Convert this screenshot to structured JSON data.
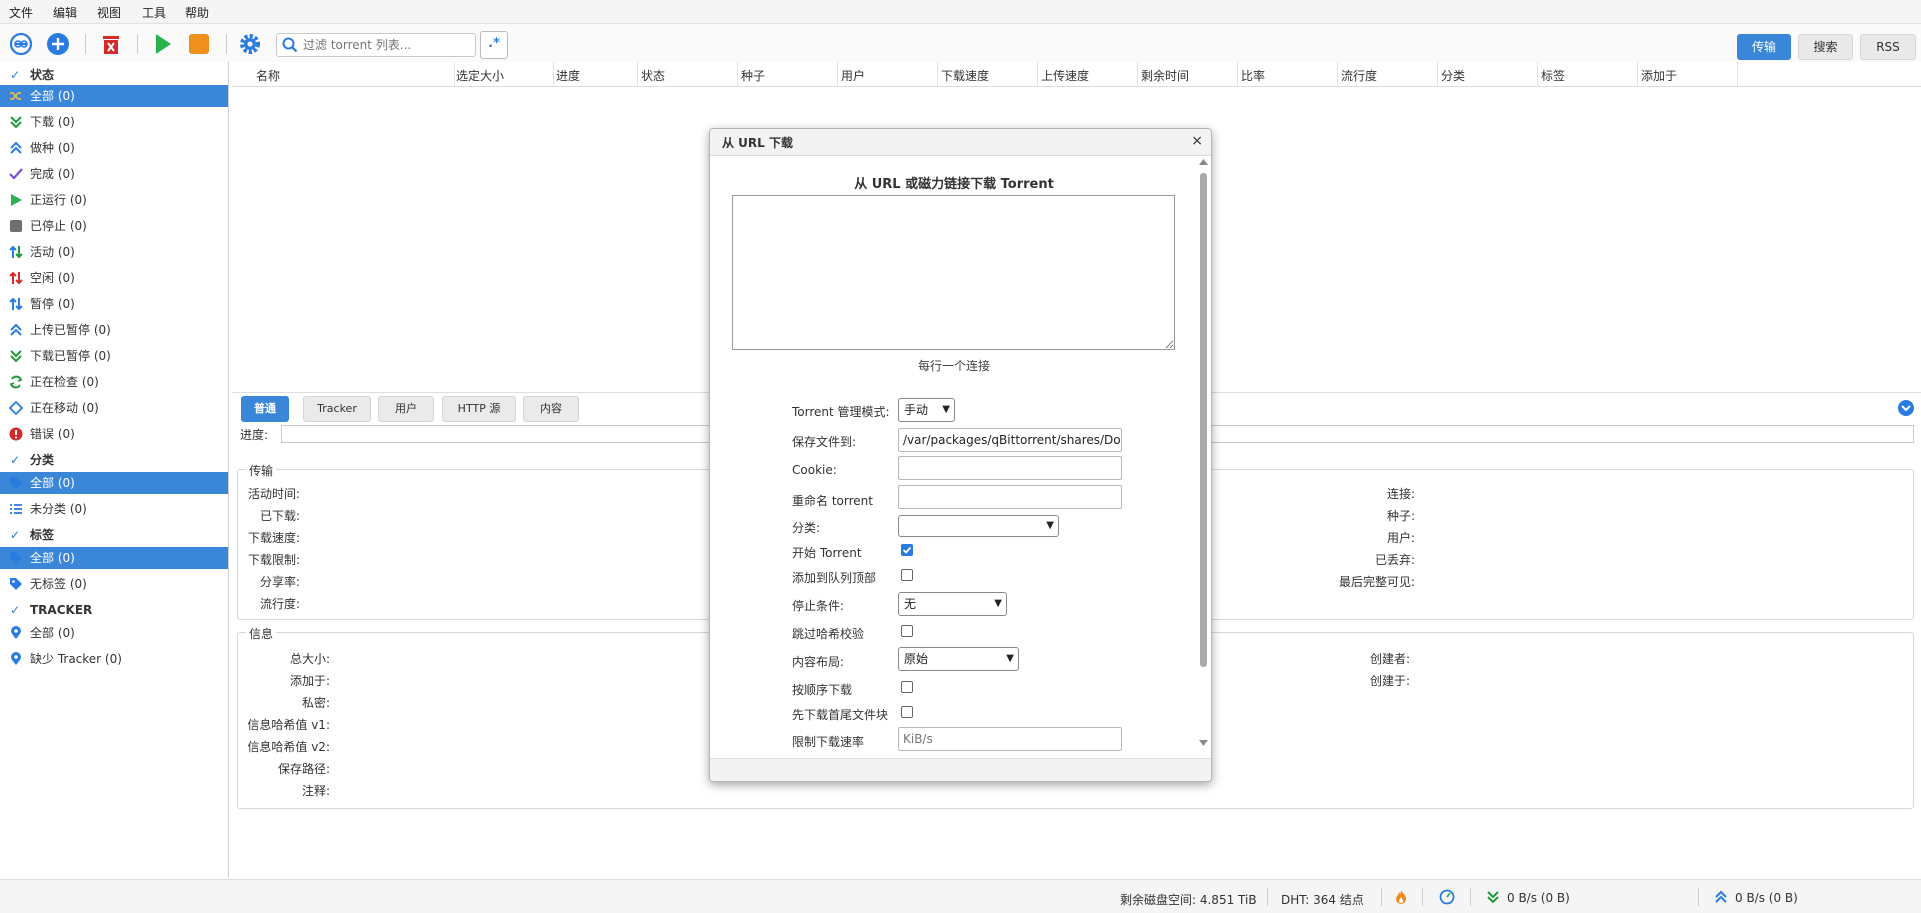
{
  "menu": [
    "文件",
    "编辑",
    "视图",
    "工具",
    "帮助"
  ],
  "toolbar": {
    "search_placeholder": "过滤 torrent 列表...",
    "regex_label": ".*",
    "tabs": [
      "传输",
      "搜索",
      "RSS"
    ],
    "accent": "#3a86d8"
  },
  "sidebar": {
    "status_header": "状态",
    "status_items": [
      {
        "label": "全部 (0)",
        "icon": "shuffle-icon"
      },
      {
        "label": "下载 (0)",
        "icon": "download-icon"
      },
      {
        "label": "做种 (0)",
        "icon": "upload-icon"
      },
      {
        "label": "完成 (0)",
        "icon": "checkmark-icon"
      },
      {
        "label": "正运行 (0)",
        "icon": "play-icon"
      },
      {
        "label": "已停止 (0)",
        "icon": "stop-icon"
      },
      {
        "label": "活动 (0)",
        "icon": "activity-icon"
      },
      {
        "label": "空闲 (0)",
        "icon": "idle-icon"
      },
      {
        "label": "暂停 (0)",
        "icon": "stalled-icon"
      },
      {
        "label": "上传已暂停 (0)",
        "icon": "upload-stalled-icon"
      },
      {
        "label": "下载已暂停 (0)",
        "icon": "download-stalled-icon"
      },
      {
        "label": "正在检查 (0)",
        "icon": "checking-icon"
      },
      {
        "label": "正在移动 (0)",
        "icon": "moving-icon"
      },
      {
        "label": "错误 (0)",
        "icon": "error-icon"
      }
    ],
    "category_header": "分类",
    "category_items": [
      {
        "label": "全部 (0)",
        "icon": "tag-icon"
      },
      {
        "label": "未分类 (0)",
        "icon": "list-icon"
      }
    ],
    "tag_header": "标签",
    "tag_items": [
      {
        "label": "全部 (0)",
        "icon": "tag-icon"
      },
      {
        "label": "无标签 (0)",
        "icon": "tag-icon"
      }
    ],
    "tracker_header": "TRACKER",
    "tracker_items": [
      {
        "label": "全部 (0)",
        "icon": "location-icon"
      },
      {
        "label": "缺少 Tracker (0)",
        "icon": "location-icon"
      }
    ]
  },
  "table": {
    "columns": [
      "名称",
      "选定大小",
      "进度",
      "状态",
      "种子",
      "用户",
      "下载速度",
      "上传速度",
      "剩余时间",
      "比率",
      "流行度",
      "分类",
      "标签",
      "添加于"
    ]
  },
  "details": {
    "tabs": [
      "普通",
      "Tracker",
      "用户",
      "HTTP 源",
      "内容"
    ],
    "progress_label": "进度:",
    "transfer_title": "传输",
    "transfer_left": [
      "活动时间:",
      "已下载:",
      "下载速度:",
      "下载限制:",
      "分享率:",
      "流行度:"
    ],
    "transfer_right": [
      "连接:",
      "种子:",
      "用户:",
      "已丢弃:",
      "最后完整可见:"
    ],
    "info_title": "信息",
    "info_left": [
      "总大小:",
      "添加于:",
      "私密:",
      "信息哈希值 v1:",
      "信息哈希值 v2:",
      "保存路径:",
      "注释:"
    ],
    "info_right": [
      "创建者:",
      "创建于:"
    ]
  },
  "statusbar": {
    "disk": "剩余磁盘空间: 4.851 TiB",
    "dht": "DHT: 364 结点",
    "download": "0 B/s (0 B)",
    "upload": "0 B/s (0 B)"
  },
  "dialog": {
    "title": "从 URL 下载",
    "heading": "从 URL 或磁力链接下载 Torrent",
    "urls_value": "",
    "hint": "每行一个连接",
    "fields": {
      "mode_label": "Torrent 管理模式:",
      "mode_value": "手动",
      "save_label": "保存文件到:",
      "save_value": "/var/packages/qBittorrent/shares/Dow",
      "cookie_label": "Cookie:",
      "cookie_value": "",
      "rename_label": "重命名 torrent",
      "rename_value": "",
      "category_label": "分类:",
      "category_value": "",
      "start_label": "开始 Torrent",
      "start_checked": true,
      "queue_top_label": "添加到队列顶部",
      "queue_top_checked": false,
      "stop_label": "停止条件:",
      "stop_value": "无",
      "skip_hash_label": "跳过哈希校验",
      "skip_hash_checked": false,
      "layout_label": "内容布局:",
      "layout_value": "原始",
      "sequential_label": "按顺序下载",
      "sequential_checked": false,
      "first_last_label": "先下载首尾文件块",
      "first_last_checked": false,
      "dl_limit_label": "限制下载速率",
      "dl_limit_placeholder": "KiB/s"
    }
  }
}
